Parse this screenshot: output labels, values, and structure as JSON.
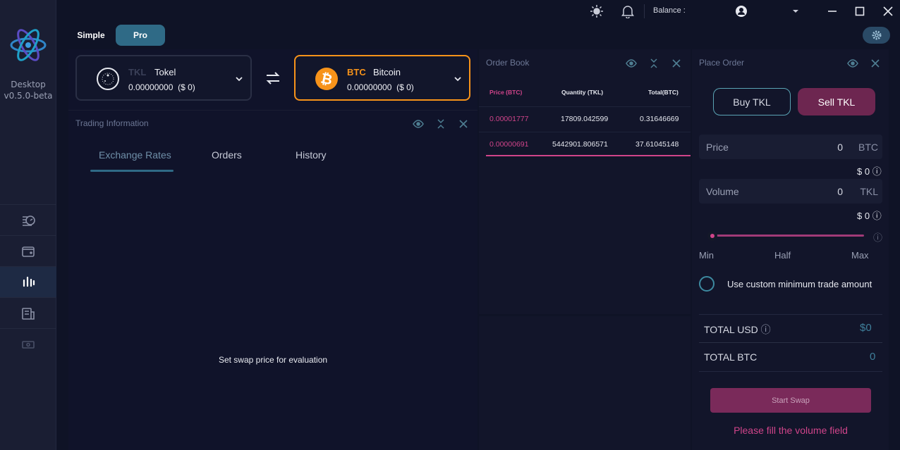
{
  "sidebar": {
    "app_name": "Desktop",
    "version": "v0.5.0-beta",
    "nav": [
      {
        "icon": "speed-dashboard-icon"
      },
      {
        "icon": "wallet-icon"
      },
      {
        "icon": "exchange-chart-icon",
        "active": true
      },
      {
        "icon": "history-receipt-icon"
      },
      {
        "icon": "fiat-card-icon"
      }
    ]
  },
  "topbar": {
    "balance_label": "Balance :",
    "icons": [
      "theme-sun-icon",
      "notification-bell-icon",
      "user-icon",
      "chevron-down-icon",
      "minimize-icon",
      "maximize-icon",
      "close-icon"
    ]
  },
  "mode": {
    "simple": "Simple",
    "pro": "Pro",
    "selected": "Pro"
  },
  "sell_coin": {
    "ticker": "TKL",
    "name": "Tokel",
    "amount": "0.00000000",
    "usd": "($ 0)"
  },
  "buy_coin": {
    "ticker": "BTC",
    "name": "Bitcoin",
    "amount": "0.00000000",
    "usd": "($ 0)"
  },
  "trading_info": {
    "title": "Trading Information",
    "tabs": [
      "Exchange Rates",
      "Orders",
      "History"
    ],
    "active_tab": "Exchange Rates",
    "empty_message": "Set swap price for evaluation"
  },
  "order_book": {
    "title": "Order Book",
    "headers": [
      "Price (BTC)",
      "Quantity (TKL)",
      "Total(BTC)"
    ],
    "rows": [
      {
        "price": "0.00001777",
        "quantity": "17809.042599",
        "total": "0.31646669"
      },
      {
        "price": "0.00000691",
        "quantity": "5442901.806571",
        "total": "37.61045148"
      }
    ]
  },
  "place_order": {
    "title": "Place Order",
    "buy_label": "Buy TKL",
    "sell_label": "Sell TKL",
    "price": {
      "label": "Price",
      "value": "0",
      "unit": "BTC",
      "usd": "$ 0"
    },
    "volume": {
      "label": "Volume",
      "value": "0",
      "unit": "TKL",
      "usd": "$ 0"
    },
    "slider": {
      "min": "Min",
      "half": "Half",
      "max": "Max",
      "level": 0
    },
    "custom_min_label": "Use custom minimum trade amount",
    "total_usd_label": "TOTAL USD",
    "total_usd_value": "$0",
    "total_btc_label": "TOTAL BTC",
    "total_btc_value": "0",
    "start_label": "Start Swap",
    "warning": "Please fill the volume field"
  },
  "colors": {
    "accent_teal": "#2f6a86",
    "accent_magenta": "#d0448a",
    "btc_orange": "#f7931a"
  }
}
